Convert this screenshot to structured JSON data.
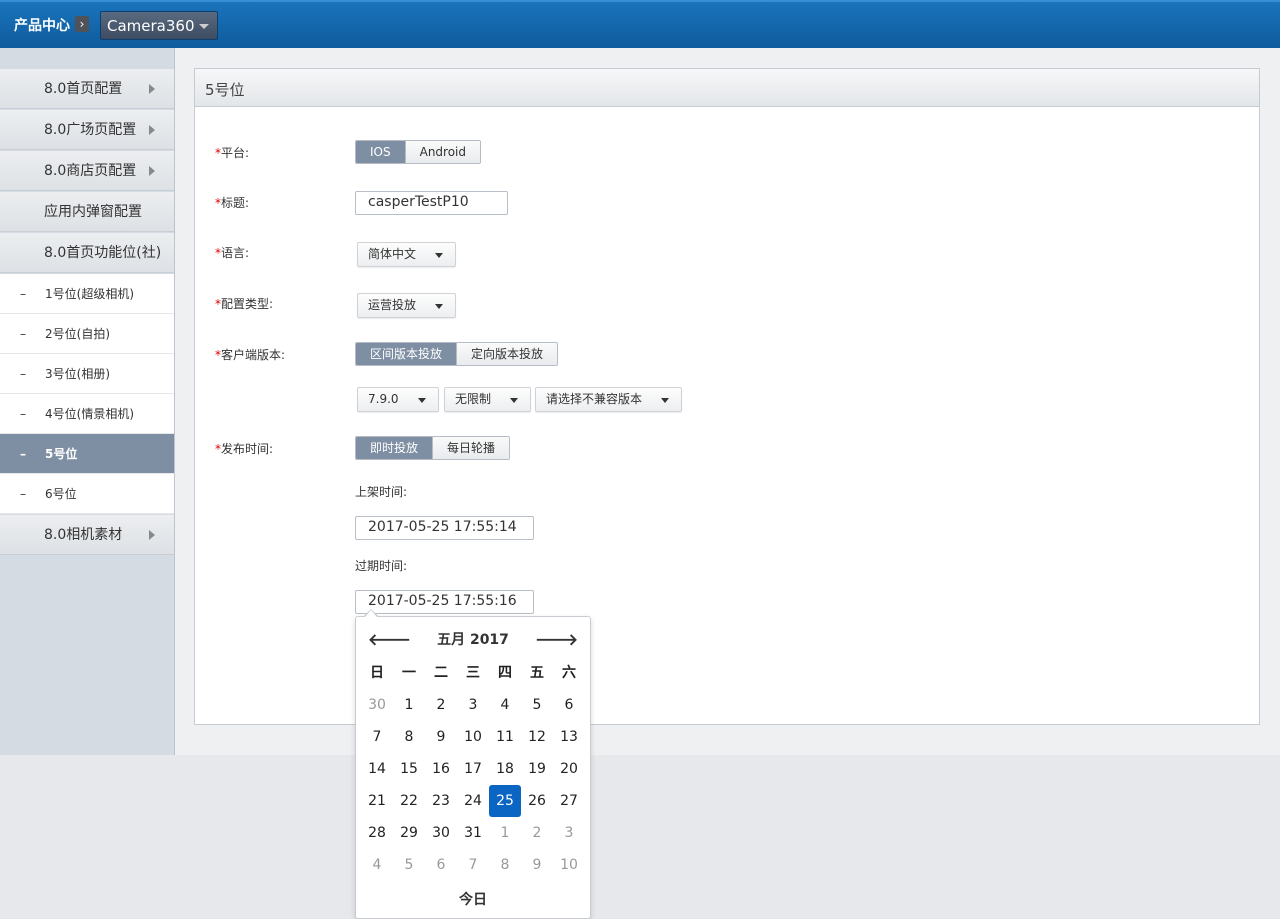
{
  "topbar": {
    "brand": "产品中心",
    "brand_arrow": "›",
    "app": "Camera360"
  },
  "sidebar": {
    "items": [
      {
        "label": "8.0首页配置",
        "arrow": true
      },
      {
        "label": "8.0广场页配置",
        "arrow": true
      },
      {
        "label": "8.0商店页配置",
        "arrow": true
      },
      {
        "label": "应用内弹窗配置",
        "arrow": false
      },
      {
        "label": "8.0首页功能位(社)",
        "arrow": false
      }
    ],
    "subitems": [
      {
        "label": "1号位(超级相机)"
      },
      {
        "label": "2号位(自拍)"
      },
      {
        "label": "3号位(相册)"
      },
      {
        "label": "4号位(情景相机)"
      },
      {
        "label": "5号位",
        "active": true
      },
      {
        "label": "6号位"
      }
    ],
    "last_item": {
      "label": "8.0相机素材",
      "arrow": true
    },
    "dash": "–"
  },
  "panel": {
    "title": "5号位"
  },
  "form": {
    "required_mark": "*",
    "platform": {
      "label": "平台:",
      "options": [
        "IOS",
        "Android"
      ],
      "selected": "IOS"
    },
    "title": {
      "label": "标题:",
      "value": "casperTestP10"
    },
    "language": {
      "label": "语言:",
      "value": "简体中文"
    },
    "config_type": {
      "label": "配置类型:",
      "value": "运营投放"
    },
    "client_version": {
      "label": "客户端版本:",
      "options": [
        "区间版本投放",
        "定向版本投放"
      ],
      "selected": "区间版本投放",
      "min_version": "7.9.0",
      "max_version": "无限制",
      "incompatible": "请选择不兼容版本"
    },
    "publish_time": {
      "label": "发布时间:",
      "options": [
        "即时投放",
        "每日轮播"
      ],
      "selected": "即时投放",
      "start_label": "上架时间:",
      "start_value": "2017-05-25 17:55:14",
      "end_label": "过期时间:",
      "end_value": "2017-05-25 17:55:16"
    }
  },
  "calendar": {
    "title": "五月 2017",
    "prev": "🡐",
    "next": "🡒",
    "weekdays": [
      "日",
      "一",
      "二",
      "三",
      "四",
      "五",
      "六"
    ],
    "weeks": [
      [
        {
          "d": "30",
          "m": true
        },
        {
          "d": "1"
        },
        {
          "d": "2"
        },
        {
          "d": "3"
        },
        {
          "d": "4"
        },
        {
          "d": "5"
        },
        {
          "d": "6"
        }
      ],
      [
        {
          "d": "7"
        },
        {
          "d": "8"
        },
        {
          "d": "9"
        },
        {
          "d": "10"
        },
        {
          "d": "11"
        },
        {
          "d": "12"
        },
        {
          "d": "13"
        }
      ],
      [
        {
          "d": "14"
        },
        {
          "d": "15"
        },
        {
          "d": "16"
        },
        {
          "d": "17"
        },
        {
          "d": "18"
        },
        {
          "d": "19"
        },
        {
          "d": "20"
        }
      ],
      [
        {
          "d": "21"
        },
        {
          "d": "22"
        },
        {
          "d": "23"
        },
        {
          "d": "24"
        },
        {
          "d": "25",
          "sel": true
        },
        {
          "d": "26"
        },
        {
          "d": "27"
        }
      ],
      [
        {
          "d": "28"
        },
        {
          "d": "29"
        },
        {
          "d": "30"
        },
        {
          "d": "31"
        },
        {
          "d": "1",
          "m": true
        },
        {
          "d": "2",
          "m": true
        },
        {
          "d": "3",
          "m": true
        }
      ],
      [
        {
          "d": "4",
          "m": true
        },
        {
          "d": "5",
          "m": true
        },
        {
          "d": "6",
          "m": true
        },
        {
          "d": "7",
          "m": true
        },
        {
          "d": "8",
          "m": true
        },
        {
          "d": "9",
          "m": true
        },
        {
          "d": "10",
          "m": true
        }
      ]
    ],
    "today": "今日"
  },
  "colors": {
    "topbar": "#0f5b9d",
    "active": "#7f8fa3",
    "selected_day": "#0a66c2",
    "required": "#dd0000"
  }
}
